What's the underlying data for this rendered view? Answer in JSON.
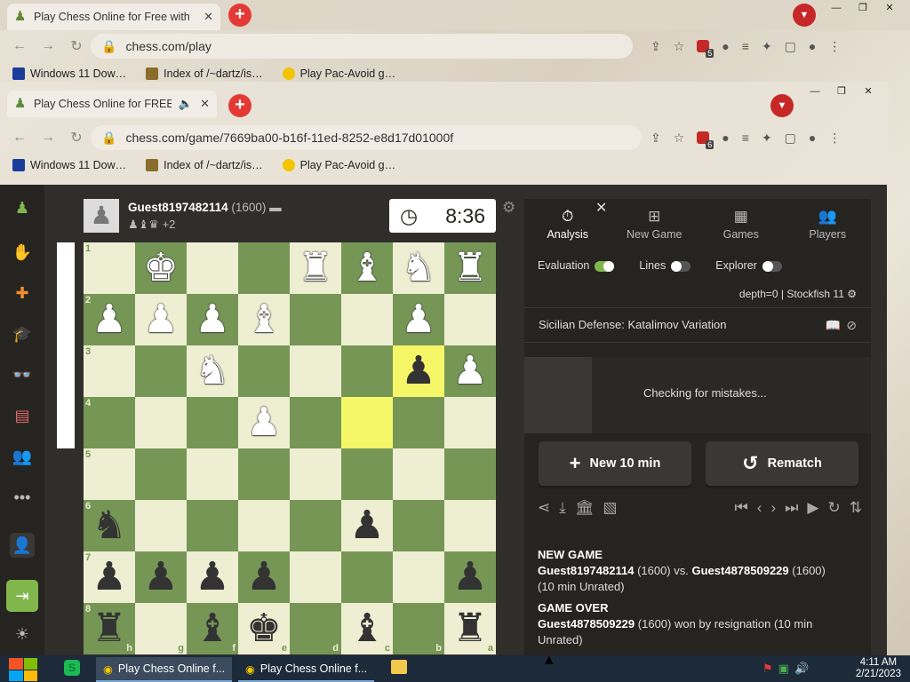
{
  "outer_browser": {
    "tab_title": "Play Chess Online for Free with",
    "url": "chess.com/play",
    "ext_badge": "5"
  },
  "inner_browser": {
    "tab_title": "Play Chess Online for FREE",
    "url": "chess.com/game/7669ba00-b16f-11ed-8252-e8d17d01000f",
    "ext_badge": "6"
  },
  "bookmarks": [
    {
      "label": "Windows 11 Dow…"
    },
    {
      "label": "Index of /~dartz/is…"
    },
    {
      "label": "Play Pac-Avoid g…"
    }
  ],
  "player": {
    "name": "Guest8197482114",
    "rating": "(1600)",
    "captured": "♟♝♛",
    "advantage": "+2",
    "clock": "8:36"
  },
  "board": {
    "files_bottom": [
      "h",
      "g",
      "f",
      "e",
      "d",
      "c",
      "b",
      "a"
    ],
    "ranks": [
      "1",
      "2",
      "3",
      "4",
      "5",
      "6",
      "7",
      "8"
    ],
    "rows": [
      [
        "",
        "wK",
        "",
        "",
        "wR",
        "wB",
        "wN",
        "wR"
      ],
      [
        "wP",
        "wP",
        "wP",
        "wB",
        "",
        "",
        "wP",
        ""
      ],
      [
        "",
        "",
        "wN",
        "",
        "",
        "",
        "bP",
        "wP"
      ],
      [
        "",
        "",
        "",
        "wP",
        "",
        "",
        "",
        ""
      ],
      [
        "",
        "",
        "",
        "",
        "",
        "",
        "",
        ""
      ],
      [
        "bN",
        "",
        "",
        "",
        "",
        "bP",
        "",
        ""
      ],
      [
        "bP",
        "bP",
        "bP",
        "bP",
        "",
        "",
        "",
        "bP"
      ],
      [
        "bR",
        "",
        "bB",
        "bK",
        "",
        "bB",
        "",
        "bR"
      ]
    ],
    "highlight": [
      [
        2,
        6
      ],
      [
        3,
        5
      ]
    ]
  },
  "panel": {
    "tabs": [
      {
        "icon": "stopwatch-icon",
        "label": "Analysis"
      },
      {
        "icon": "plus-square-icon",
        "label": "New Game"
      },
      {
        "icon": "board-icon",
        "label": "Games"
      },
      {
        "icon": "players-icon",
        "label": "Players"
      }
    ],
    "toggles": [
      {
        "label": "Evaluation",
        "on": true
      },
      {
        "label": "Lines",
        "on": false
      },
      {
        "label": "Explorer",
        "on": false
      }
    ],
    "depth": "depth=0 |",
    "engine": "Stockfish 11",
    "opening": "Sicilian Defense: Katalimov Variation",
    "checking": "Checking for mistakes...",
    "new_game_btn": "New 10 min",
    "rematch_btn": "Rematch",
    "log": {
      "h1": "NEW GAME",
      "p1": "Guest8197482114",
      "r1": "(1600) vs.",
      "p2": "Guest4878509229",
      "r2": "(1600)",
      "mode": "(10 min Unrated)",
      "h2": "GAME OVER",
      "winner": "Guest4878509229",
      "result": "(1600) won by resignation (10 min Unrated)"
    }
  },
  "taskbar": {
    "apps": [
      {
        "label": "Play Chess Online f..."
      },
      {
        "label": "Play Chess Online f..."
      }
    ],
    "time": "4:11 AM",
    "date": "2/21/2023"
  },
  "colors": {
    "light_square": "#eeeed2",
    "dark_square": "#769656",
    "accent": "#81b64c"
  }
}
